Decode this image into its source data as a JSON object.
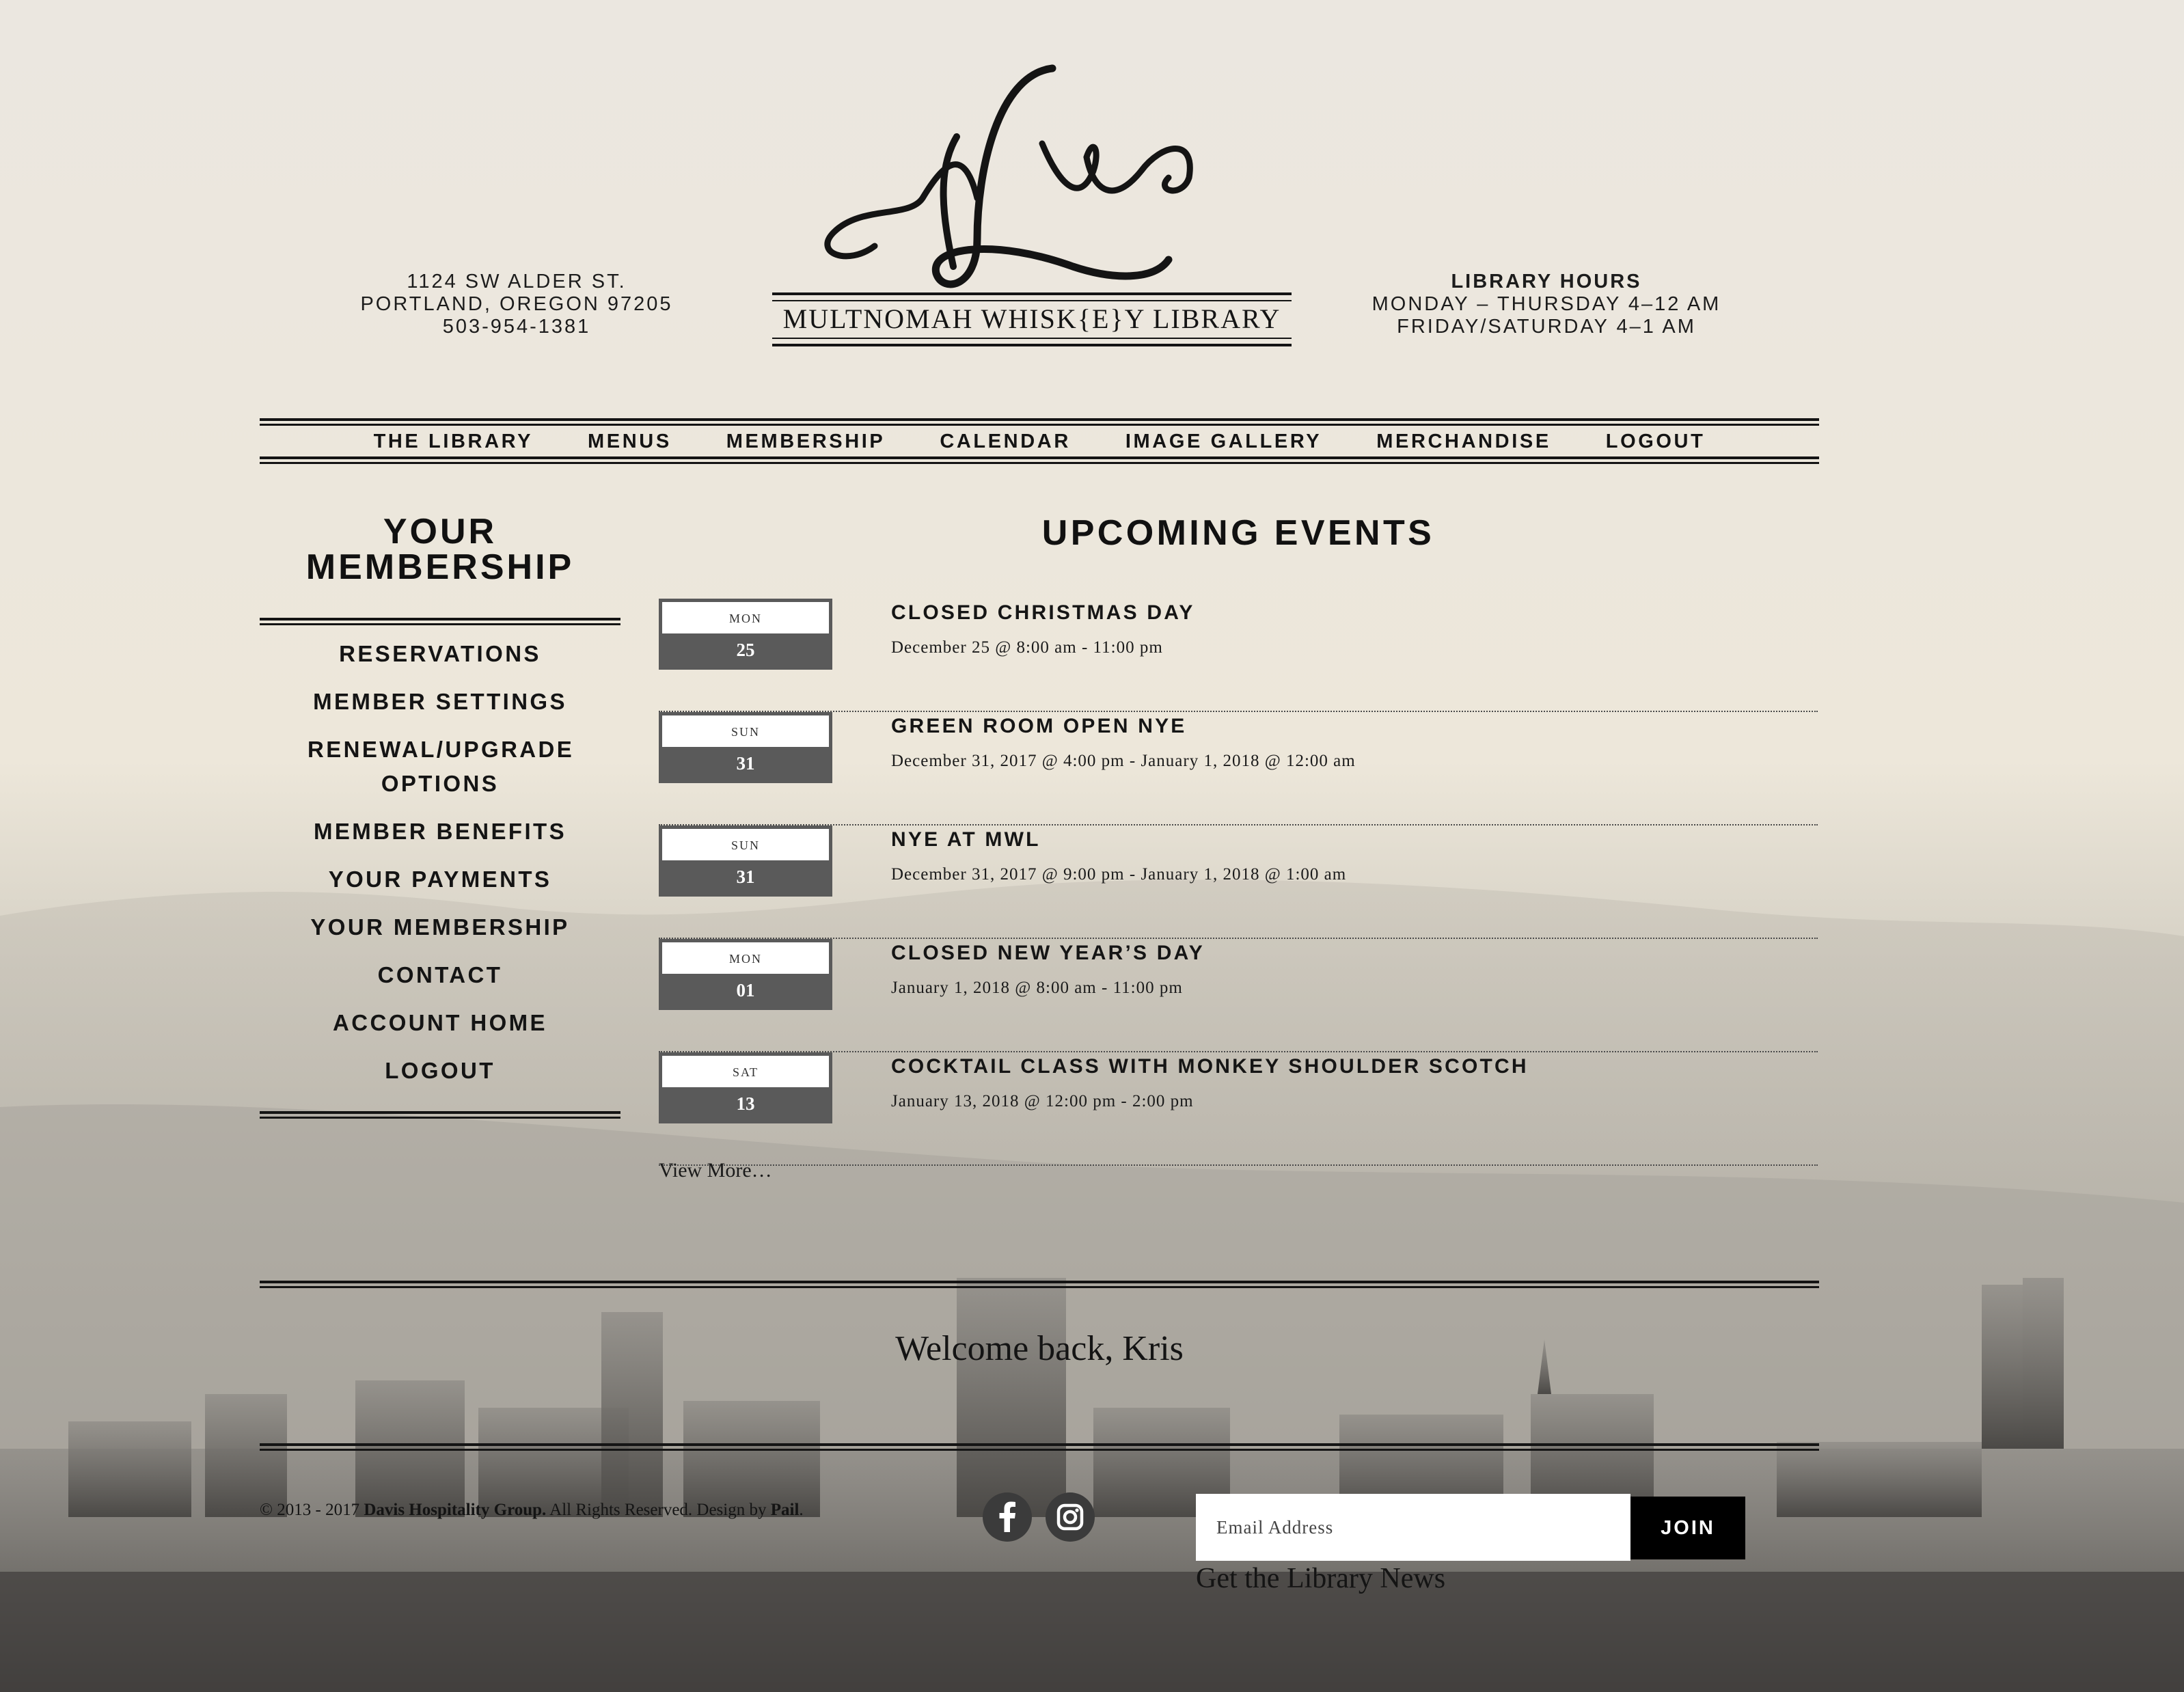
{
  "header": {
    "address": [
      "1124 SW ALDER ST.",
      "PORTLAND, OREGON 97205",
      "503-954-1381"
    ],
    "logo_monogram": "MLW",
    "logo_text": "MULTNOMAH WHISK{E}Y LIBRARY",
    "hours_title": "LIBRARY HOURS",
    "hours_lines": [
      "MONDAY – THURSDAY 4–12 AM",
      "FRIDAY/SATURDAY 4–1 AM"
    ]
  },
  "nav": {
    "items": [
      {
        "label": "THE LIBRARY"
      },
      {
        "label": "MENUS"
      },
      {
        "label": "MEMBERSHIP"
      },
      {
        "label": "CALENDAR"
      },
      {
        "label": "IMAGE GALLERY"
      },
      {
        "label": "MERCHANDISE"
      },
      {
        "label": "LOGOUT"
      }
    ]
  },
  "sidebar": {
    "title_line1": "YOUR",
    "title_line2": "MEMBERSHIP",
    "items": [
      {
        "label": "RESERVATIONS"
      },
      {
        "label": "MEMBER SETTINGS"
      },
      {
        "label": "RENEWAL/UPGRADE OPTIONS"
      },
      {
        "label": "MEMBER BENEFITS"
      },
      {
        "label": "YOUR PAYMENTS"
      },
      {
        "label": "YOUR MEMBERSHIP"
      },
      {
        "label": "CONTACT"
      },
      {
        "label": "ACCOUNT HOME"
      },
      {
        "label": "LOGOUT"
      }
    ]
  },
  "events": {
    "title": "UPCOMING EVENTS",
    "items": [
      {
        "dow": "MON",
        "day": "25",
        "name": "CLOSED CHRISTMAS DAY",
        "when": "December 25 @ 8:00 am - 11:00 pm"
      },
      {
        "dow": "SUN",
        "day": "31",
        "name": "GREEN ROOM OPEN NYE",
        "when": "December 31, 2017 @ 4:00 pm - January 1, 2018 @ 12:00 am"
      },
      {
        "dow": "SUN",
        "day": "31",
        "name": "NYE AT MWL",
        "when": "December 31, 2017 @ 9:00 pm - January 1, 2018 @ 1:00 am"
      },
      {
        "dow": "MON",
        "day": "01",
        "name": "CLOSED NEW YEAR’S DAY",
        "when": "January 1, 2018 @ 8:00 am - 11:00 pm"
      },
      {
        "dow": "SAT",
        "day": "13",
        "name": "COCKTAIL CLASS WITH MONKEY SHOULDER SCOTCH",
        "when": "January 13, 2018 @ 12:00 pm - 2:00 pm"
      }
    ],
    "view_more": "View More…"
  },
  "welcome": "Welcome back, Kris",
  "footer": {
    "copyright_prefix": "© 2013 - 2017 ",
    "company": "Davis Hospitality Group.",
    "rights": " All Rights Reserved. Design by ",
    "designer": "Pail",
    "period": ".",
    "social_icons": [
      "facebook-icon",
      "instagram-icon"
    ],
    "email_placeholder": "Email Address",
    "join_label": "JOIN",
    "news_label": "Get the Library News"
  },
  "colors": {
    "page_bg": "#ece7de",
    "text": "#141414",
    "date_box": "#5a5a5a",
    "join_bg": "#000000"
  }
}
